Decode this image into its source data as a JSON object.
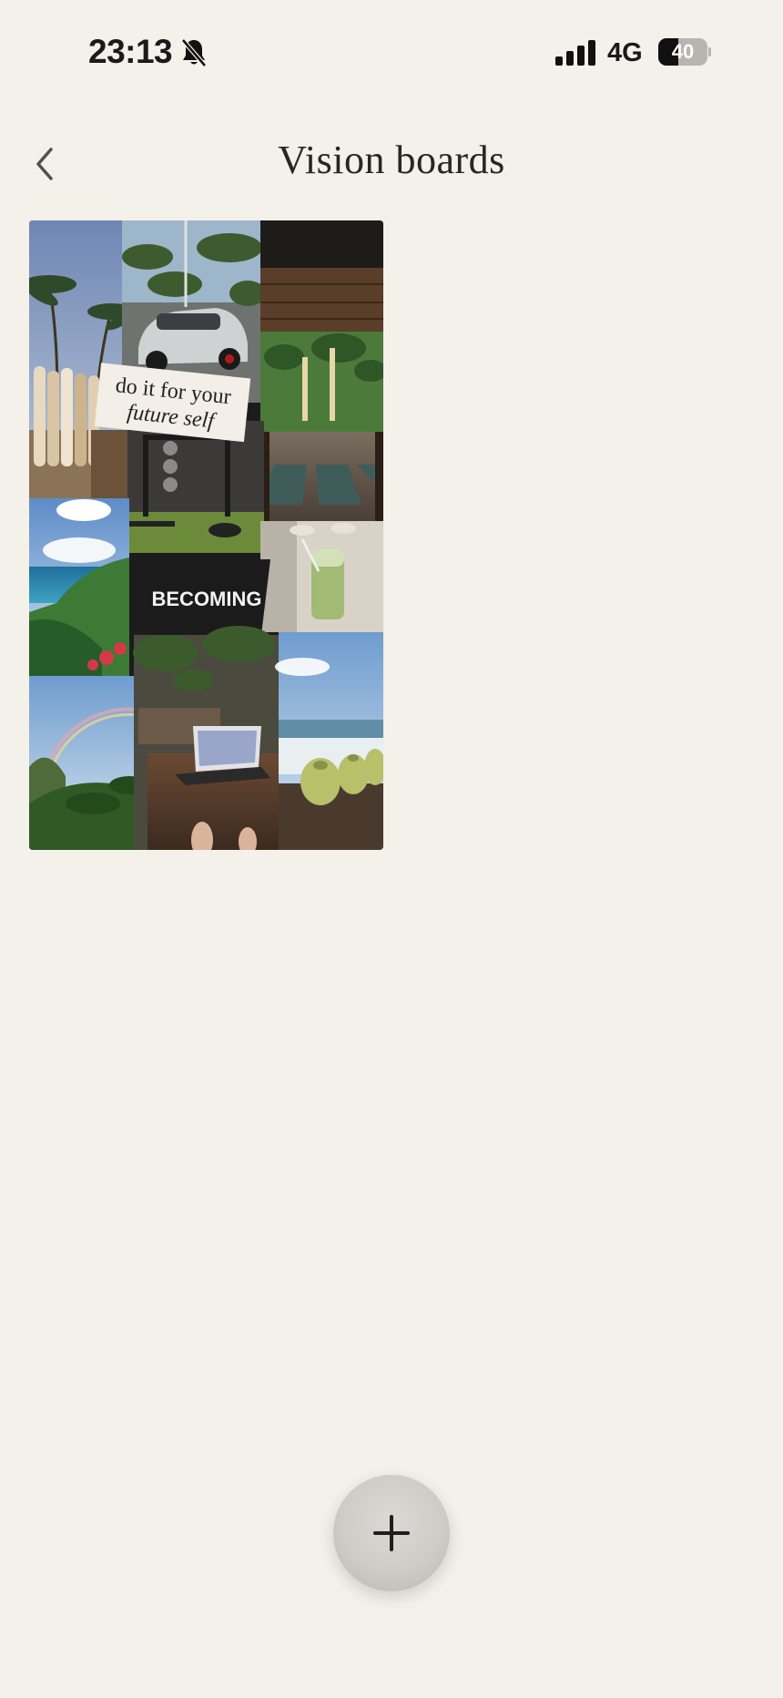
{
  "status_bar": {
    "time": "23:13",
    "network": "4G",
    "battery_percent": 40,
    "battery_label": "40",
    "icons": [
      "bell-slash-icon",
      "cellular-signal-icon",
      "battery-icon"
    ]
  },
  "header": {
    "title": "Vision boards",
    "back_icon": "chevron-left-icon"
  },
  "boards": [
    {
      "quote_line1": "do it for your",
      "quote_line2": "future self",
      "sticker": "BECOMING",
      "images": [
        "palm-trees-surfboards",
        "silver-porsche",
        "thatched-yoga-pavilion",
        "home-gym",
        "tropical-coast-flowers",
        "matcha-latte",
        "rainbow-jungle",
        "cafe-laptop",
        "beach-coconuts"
      ]
    }
  ],
  "fab": {
    "icon": "plus-icon"
  },
  "colors": {
    "background": "#f4f0ea",
    "text": "#2a2622",
    "fab": "#d3d0cc"
  }
}
